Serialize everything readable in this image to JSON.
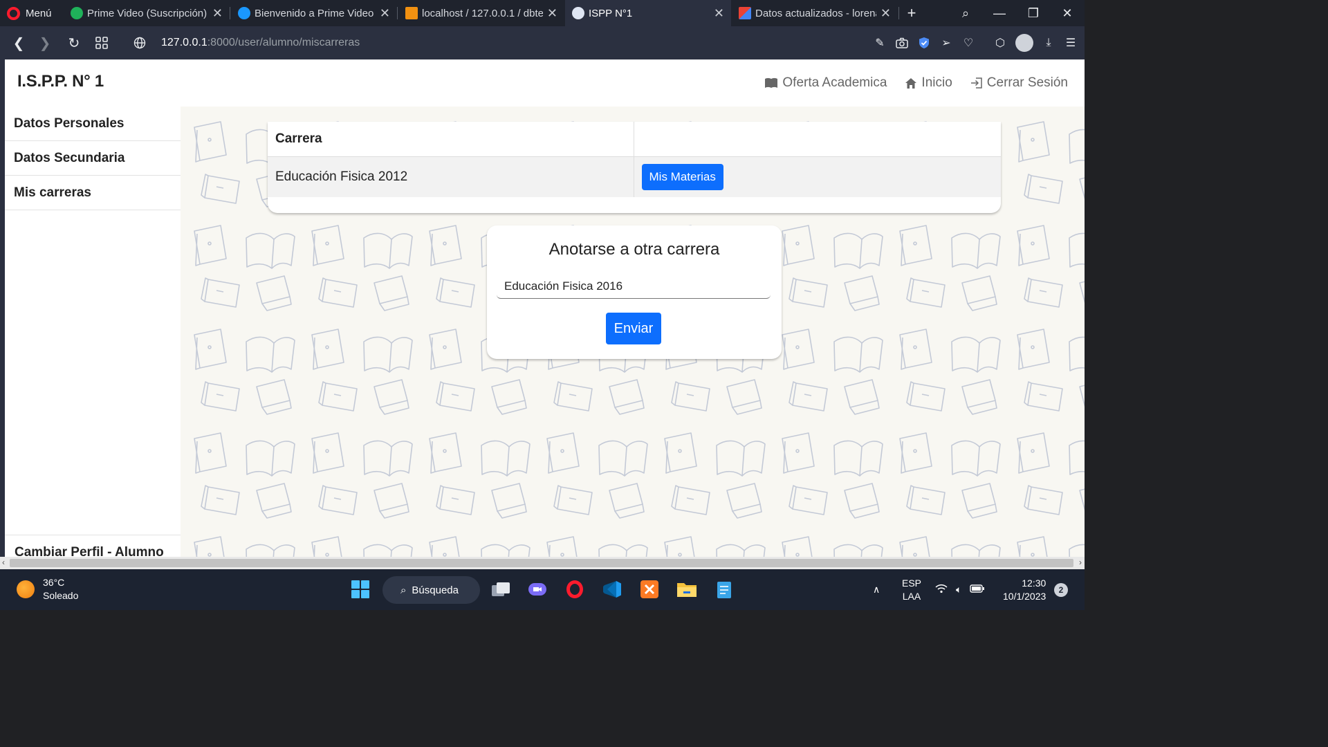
{
  "browser": {
    "menu_label": "Menú",
    "tabs": [
      {
        "title": "Prime Video (Suscripción) -"
      },
      {
        "title": "Bienvenido a Prime Video"
      },
      {
        "title": "localhost / 127.0.0.1 / dbte"
      },
      {
        "title": "ISPP N°1"
      },
      {
        "title": "Datos actualizados - lorena"
      }
    ],
    "url_host": "127.0.0.1",
    "url_path": ":8000/user/alumno/miscarreras"
  },
  "header": {
    "brand": "I.S.P.P. N° 1",
    "nav": {
      "oferta": "Oferta Academica",
      "inicio": "Inicio",
      "cerrar": "Cerrar Sesión"
    }
  },
  "sidebar": {
    "items": [
      {
        "label": "Datos Personales"
      },
      {
        "label": "Datos Secundaria"
      },
      {
        "label": "Mis carreras"
      }
    ],
    "bottom": "Cambiar Perfil - Alumno"
  },
  "careers_table": {
    "header": "Carrera",
    "rows": [
      {
        "career": "Educación Fisica 2012",
        "button": "Mis Materias"
      }
    ]
  },
  "enroll_form": {
    "title": "Anotarse a otra carrera",
    "selected": "Educación Fisica 2016",
    "submit": "Enviar"
  },
  "taskbar": {
    "temperature": "36°C",
    "weather": "Soleado",
    "search": "Búsqueda",
    "lang_top": "ESP",
    "lang_bottom": "LAA",
    "time": "12:30",
    "date": "10/1/2023",
    "notifications": "2"
  },
  "colors": {
    "primary": "#0d6efd",
    "page_bg": "#f8f7f2"
  }
}
